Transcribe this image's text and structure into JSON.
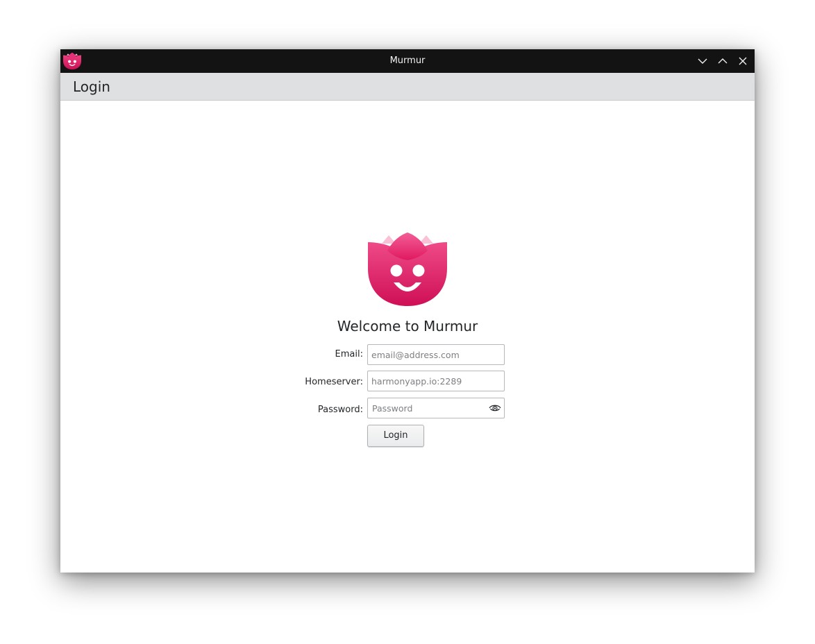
{
  "window": {
    "title": "Murmur",
    "controls": {
      "minimize_icon": "chevron-down-icon",
      "maximize_icon": "chevron-up-icon",
      "close_icon": "close-icon"
    },
    "titlebar_color": "#131313"
  },
  "page": {
    "title": "Login",
    "bar_color": "#dfe0e2"
  },
  "login": {
    "logo_icon": "tulip-smiley-icon",
    "brand_color": "#e0195f",
    "welcome": "Welcome to Murmur",
    "email": {
      "label": "Email:",
      "value": "",
      "placeholder": "email@address.com"
    },
    "homeserver": {
      "label": "Homeserver:",
      "value": "",
      "placeholder": "harmonyapp.io:2289"
    },
    "password": {
      "label": "Password:",
      "value": "",
      "placeholder": "Password",
      "reveal_icon": "eye-icon"
    },
    "submit_label": "Login"
  }
}
